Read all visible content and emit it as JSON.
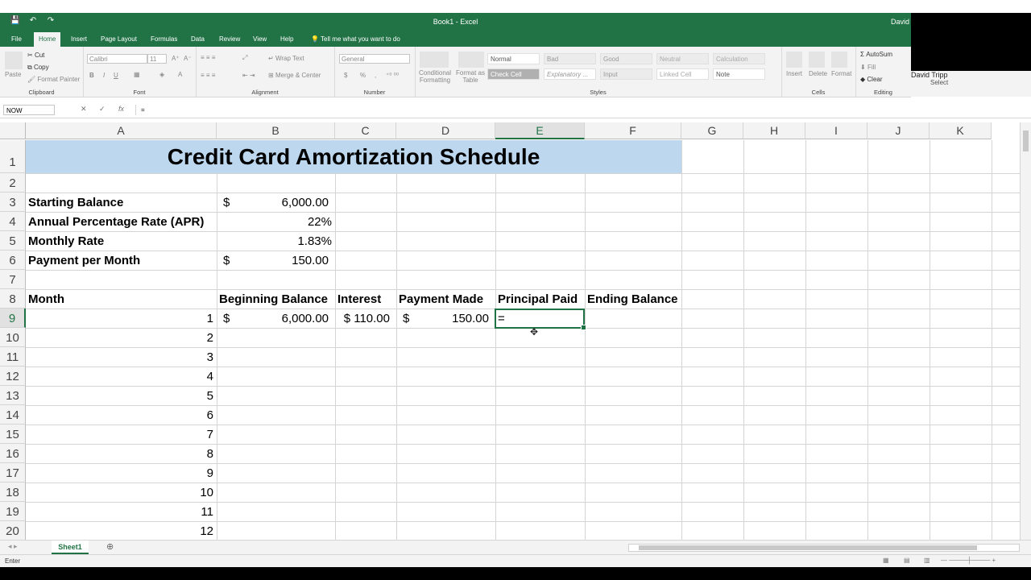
{
  "window": {
    "title": "Book1  -  Excel",
    "user": "David",
    "qat": [
      "💾",
      "↶",
      "↷"
    ]
  },
  "tabs": [
    "File",
    "Home",
    "Insert",
    "Page Layout",
    "Formulas",
    "Data",
    "Review",
    "View",
    "Help",
    "Tell me what you want to do"
  ],
  "ribbon": {
    "clipboard": {
      "label": "Clipboard",
      "paste": "Paste",
      "cut": "Cut",
      "copy": "Copy",
      "format_painter": "Format Painter"
    },
    "font": {
      "label": "Font",
      "name": "Calibri",
      "size": "11",
      "bold": "B",
      "italic": "I",
      "underline": "U"
    },
    "alignment": {
      "label": "Alignment",
      "wrap": "Wrap Text",
      "merge": "Merge & Center"
    },
    "number": {
      "label": "Number",
      "format": "General",
      "currency": "$",
      "percent": "%"
    },
    "styles": {
      "label": "Styles",
      "conditional": "Conditional Formatting",
      "format_table": "Format as Table",
      "cells": [
        "Normal",
        "Bad",
        "Good",
        "Neutral",
        "Calculation",
        "Check Cell",
        "Explanatory ...",
        "Input",
        "Linked Cell",
        "Note"
      ]
    },
    "cells": {
      "label": "Cells",
      "insert": "Insert",
      "delete": "Delete",
      "format": "Format"
    },
    "editing": {
      "label": "Editing",
      "autosum": "AutoSum",
      "fill": "Fill",
      "clear": "Clear",
      "user": "David Tripp",
      "select": "Select"
    }
  },
  "formula_bar": {
    "name_box": "NOW",
    "cancel": "✕",
    "enter": "✓",
    "fx": "fx",
    "content": "="
  },
  "columns": [
    "A",
    "B",
    "C",
    "D",
    "E",
    "F",
    "G",
    "H",
    "I",
    "J",
    "K"
  ],
  "rows": [
    "1",
    "2",
    "3",
    "4",
    "5",
    "6",
    "7",
    "8",
    "9",
    "10",
    "11",
    "12",
    "13",
    "14",
    "15",
    "16",
    "17",
    "18",
    "19",
    "20"
  ],
  "sheet": {
    "title": "Credit Card Amortization Schedule",
    "inputs": [
      {
        "label": "Starting Balance",
        "symbol": "$",
        "value": "6,000.00"
      },
      {
        "label": "Annual Percentage Rate (APR)",
        "symbol": "",
        "value": "22%"
      },
      {
        "label": "Monthly Rate",
        "symbol": "",
        "value": "1.83%"
      },
      {
        "label": "Payment per Month",
        "symbol": "$",
        "value": "150.00"
      }
    ],
    "headers": [
      "Month",
      "Beginning Balance",
      "Interest",
      "Payment Made",
      "Principal Paid",
      "Ending Balance"
    ],
    "row9": {
      "month": "1",
      "beg_symbol": "$",
      "beg_value": "6,000.00",
      "interest": "$ 110.00",
      "pay_symbol": "$",
      "pay_value": "150.00",
      "principal_entry": "="
    },
    "months": [
      "2",
      "3",
      "4",
      "5",
      "6",
      "7",
      "8",
      "9",
      "10",
      "11",
      "12"
    ]
  },
  "sheet_tabs": [
    "Sheet1"
  ],
  "status": {
    "mode": "Enter"
  }
}
